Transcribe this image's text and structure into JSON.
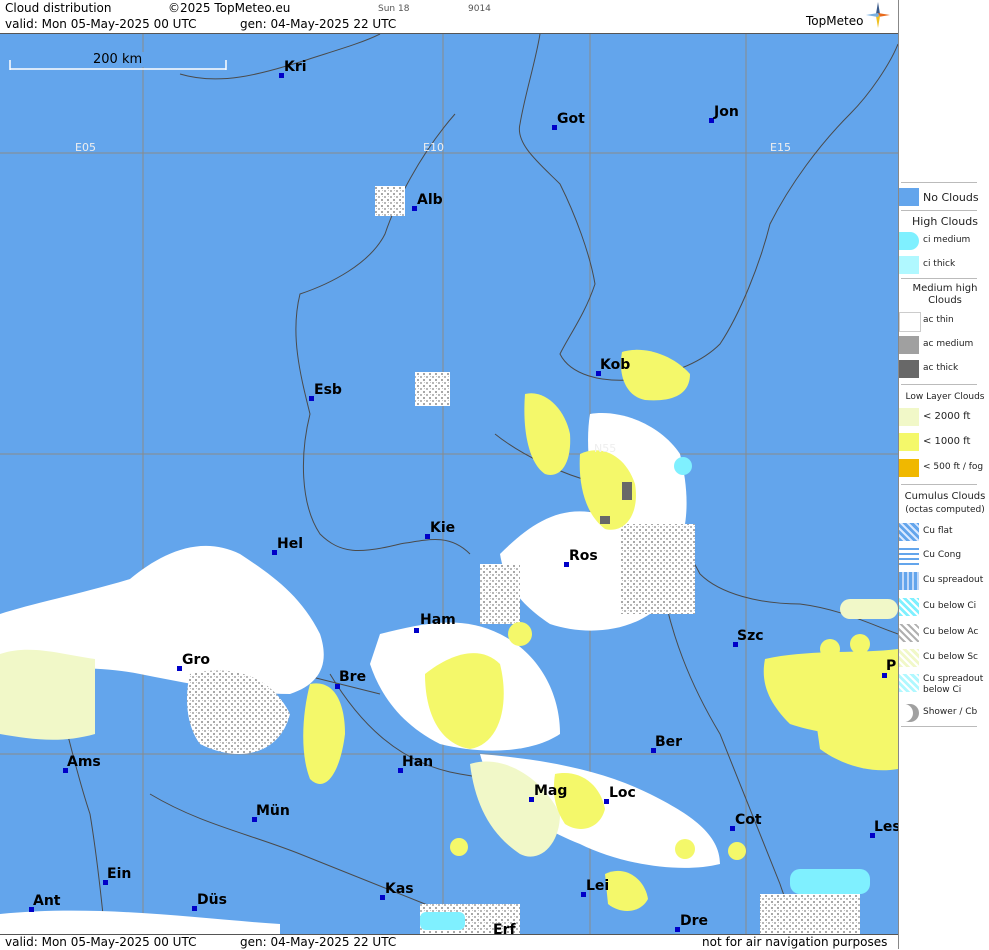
{
  "header": {
    "title": "Cloud distribution",
    "copyright": "©2025 TopMeteo.eu",
    "sun_info": "Sun 18",
    "code": "9014",
    "valid": "valid:  Mon  05-May-2025  00 UTC",
    "gen": "gen: 04-May-2025 22 UTC",
    "logo": "TopMeteo"
  },
  "footer": {
    "valid": "valid:  Mon  05-May-2025  00 UTC",
    "gen": "gen: 04-May-2025 22 UTC",
    "disclaimer": "not for air navigation purposes"
  },
  "map": {
    "scale_label": "200 km",
    "grid_labels": [
      "E05",
      "E10",
      "E15",
      "N55"
    ],
    "cities": [
      "Kri",
      "Got",
      "Jon",
      "Alb",
      "Esb",
      "Kob",
      "Kie",
      "Hel",
      "Ros",
      "Ham",
      "Szc",
      "Gro",
      "Bre",
      "Ber",
      "Ams",
      "Han",
      "Mag",
      "Loc",
      "Mün",
      "Cot",
      "Les",
      "Ein",
      "Kas",
      "Lei",
      "Ant",
      "Düs",
      "Dre",
      "Erf",
      "P"
    ]
  },
  "legend": {
    "no_clouds": "No Clouds",
    "high_title": "High Clouds",
    "ci_medium": "ci medium",
    "ci_thick": "ci thick",
    "medium_title": "Medium high Clouds",
    "ac_thin": "ac thin",
    "ac_medium": "ac medium",
    "ac_thick": "ac thick",
    "low_title": "Low Layer Clouds",
    "low_2000": "< 2000 ft",
    "low_1000": "< 1000 ft",
    "low_500": "< 500 ft / fog",
    "cumulus_title": "Cumulus Clouds",
    "cumulus_sub": "(octas computed)",
    "cu_flat": "Cu flat",
    "cu_cong": "Cu Cong",
    "cu_spreadout": "Cu spreadout",
    "cu_below_ci": "Cu below Ci",
    "cu_below_ac": "Cu below Ac",
    "cu_below_sc": "Cu below Sc",
    "cu_spreadout_below_ci": "Cu spreadout below Ci",
    "shower_cb": "Shower / Cb"
  },
  "colors": {
    "no_clouds": "#63a5ec",
    "cloud_white": "#ffffff",
    "low_yellow": "#f4f86a",
    "low_pale": "#f1f8c8",
    "fog_orange": "#f0b800",
    "ci_cyan": "#7ff0ff",
    "ac_grey": "#a0a0a0",
    "ac_dark": "#686868"
  }
}
